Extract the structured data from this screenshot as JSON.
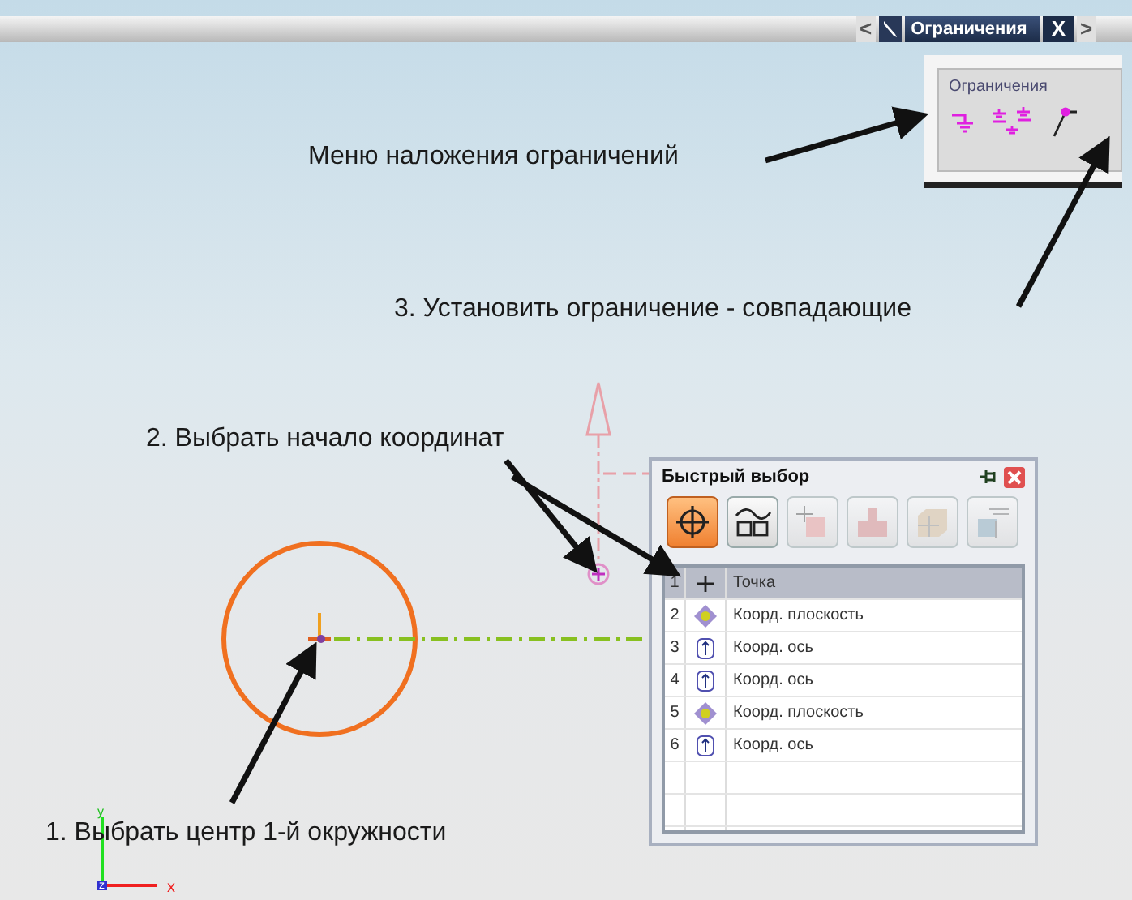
{
  "panel_tab": {
    "prev": "<",
    "title": "Ограничения",
    "close": "X",
    "next": ">"
  },
  "constraints_panel": {
    "title": "Ограничения",
    "tools": [
      {
        "kind": "fix"
      },
      {
        "kind": "fix_multi"
      },
      {
        "kind": "coincident"
      }
    ]
  },
  "quick_select": {
    "title": "Быстрый выбор",
    "filters": [
      {
        "kind": "point",
        "selected": true,
        "disabled": false
      },
      {
        "kind": "curve",
        "selected": false,
        "disabled": false
      },
      {
        "kind": "vertex",
        "selected": false,
        "disabled": true
      },
      {
        "kind": "solid",
        "selected": false,
        "disabled": true
      },
      {
        "kind": "face",
        "selected": false,
        "disabled": true
      },
      {
        "kind": "edge",
        "selected": false,
        "disabled": true
      }
    ],
    "rows": [
      {
        "index": "1",
        "kind": "point",
        "label": "Точка",
        "selected": true
      },
      {
        "index": "2",
        "kind": "plane",
        "label": "Коорд. плоскость",
        "selected": false
      },
      {
        "index": "3",
        "kind": "axis",
        "label": "Коорд. ось",
        "selected": false
      },
      {
        "index": "4",
        "kind": "axis",
        "label": "Коорд. ось",
        "selected": false
      },
      {
        "index": "5",
        "kind": "plane",
        "label": "Коорд. плоскость",
        "selected": false
      },
      {
        "index": "6",
        "kind": "axis",
        "label": "Коорд. ось",
        "selected": false
      }
    ]
  },
  "annotations": [
    "Меню наложения ограничений",
    "3. Установить ограничение - совпадающие",
    "2. Выбрать начало координат",
    "1. Выбрать центр 1-й окружности"
  ],
  "axes": {
    "x": "x",
    "y": "y",
    "z": "z"
  }
}
